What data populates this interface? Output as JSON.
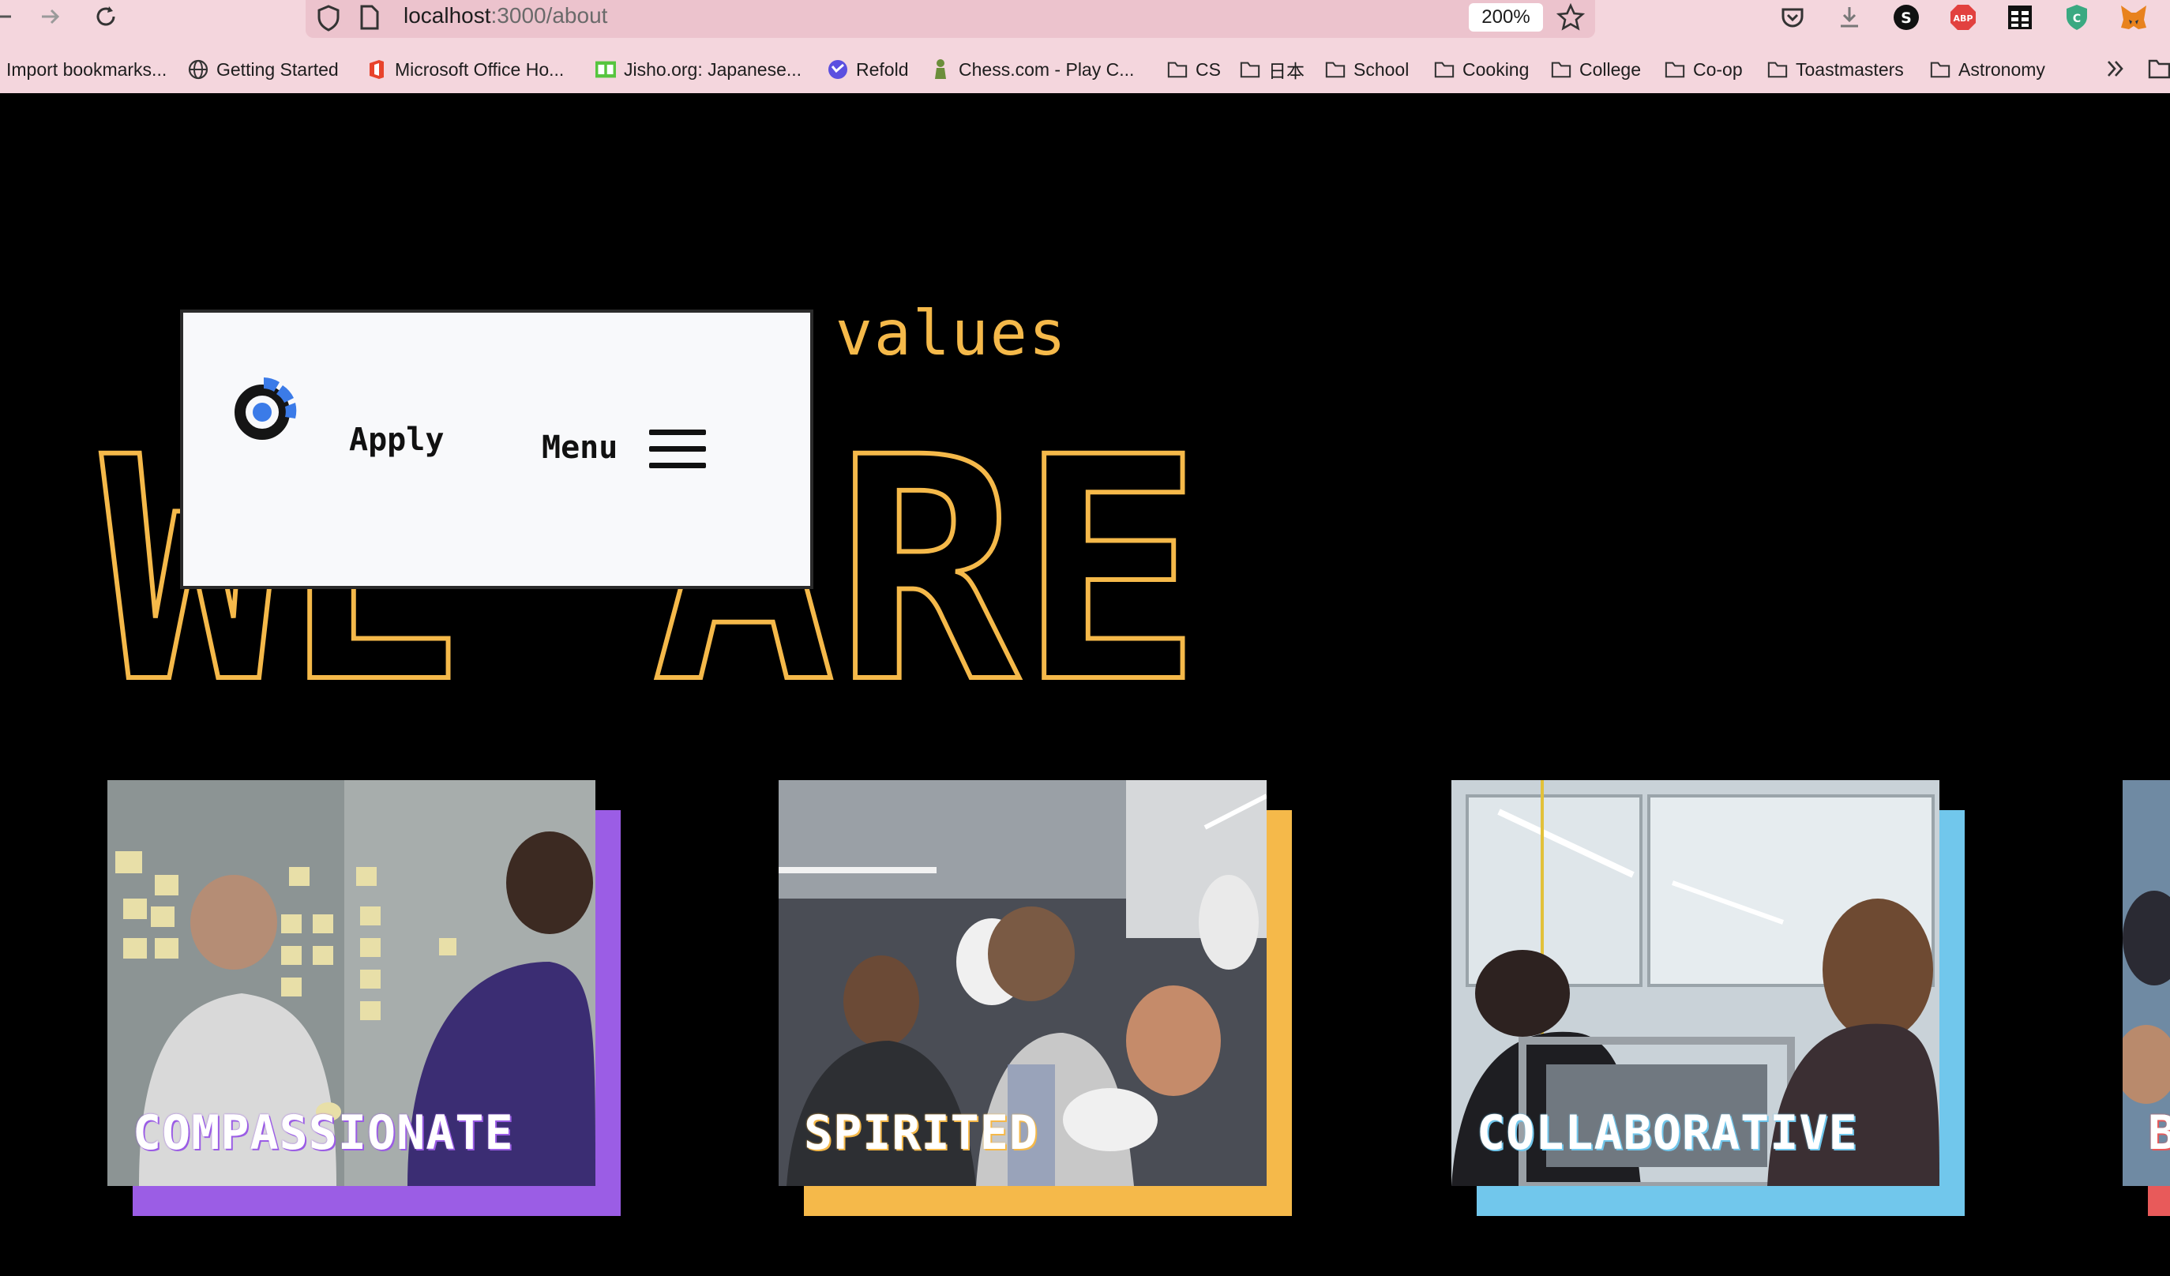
{
  "browser": {
    "url_host": "localhost",
    "url_path": ":3000/about",
    "zoom": "200%",
    "bookmarks": [
      {
        "label": "Import bookmarks...",
        "icon": "none"
      },
      {
        "label": "Getting Started",
        "icon": "globe-icon"
      },
      {
        "label": "Microsoft Office Ho...",
        "icon": "office-icon"
      },
      {
        "label": "Jisho.org: Japanese...",
        "icon": "jisho-icon"
      },
      {
        "label": "Refold",
        "icon": "refold-icon"
      },
      {
        "label": "Chess.com - Play C...",
        "icon": "chess-icon"
      },
      {
        "label": "CS",
        "icon": "folder-icon"
      },
      {
        "label": "日本",
        "icon": "folder-icon"
      },
      {
        "label": "School",
        "icon": "folder-icon"
      },
      {
        "label": "Cooking",
        "icon": "folder-icon"
      },
      {
        "label": "College",
        "icon": "folder-icon"
      },
      {
        "label": "Co-op",
        "icon": "folder-icon"
      },
      {
        "label": "Toastmasters",
        "icon": "folder-icon"
      },
      {
        "label": "Astronomy",
        "icon": "folder-icon"
      }
    ],
    "extensions": [
      "pocket-icon",
      "download-icon",
      "s-extension-icon",
      "adblock-plus-icon",
      "table-extension-icon",
      "shield-extension-icon",
      "metamask-icon"
    ]
  },
  "page": {
    "heading_small": "r values",
    "heading_big": "WE ARE",
    "accent_color": "#f5b94a",
    "cards": [
      {
        "label": "COMPASSIONATE",
        "accent": "#9b5de5"
      },
      {
        "label": "SPIRITED",
        "accent": "#f5b94a"
      },
      {
        "label": "COLLABORATIVE",
        "accent": "#71c7ec"
      },
      {
        "label": "B",
        "accent": "#e85a5a"
      }
    ]
  },
  "popup": {
    "apply_label": "Apply",
    "menu_label": "Menu",
    "logo_color": "#3b7be8"
  }
}
